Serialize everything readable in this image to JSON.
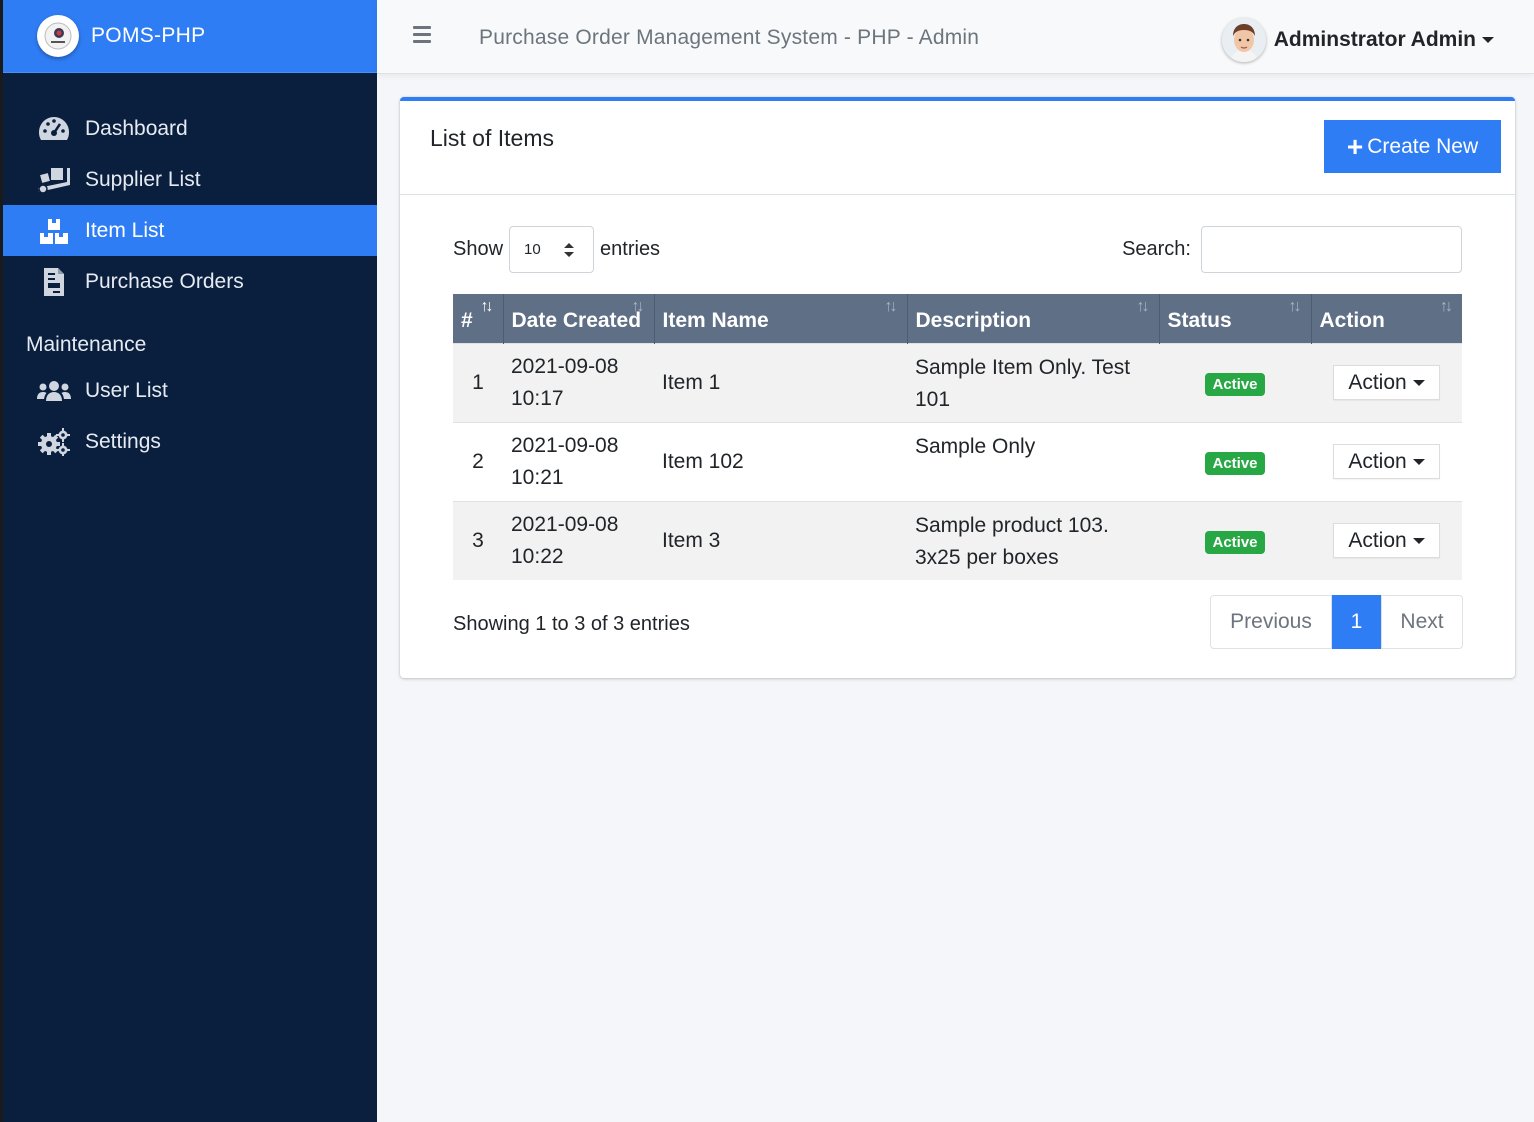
{
  "brand": {
    "name": "POMS-PHP",
    "logo_icon": "brand-logo-icon"
  },
  "topbar": {
    "title": "Purchase Order Management System - PHP - Admin",
    "user_name": "Adminstrator Admin"
  },
  "sidebar": {
    "items": [
      {
        "label": "Dashboard",
        "icon": "dashboard-icon"
      },
      {
        "label": "Supplier List",
        "icon": "truck-loading-icon"
      },
      {
        "label": "Item List",
        "icon": "boxes-icon",
        "active": true
      },
      {
        "label": "Purchase Orders",
        "icon": "file-invoice-icon"
      }
    ],
    "section_header": "Maintenance",
    "maintenance_items": [
      {
        "label": "User List",
        "icon": "users-icon"
      },
      {
        "label": "Settings",
        "icon": "cogs-icon"
      }
    ]
  },
  "card": {
    "title": "List of Items",
    "create_label": "Create New"
  },
  "controls": {
    "show_label": "Show",
    "page_size": "10",
    "entries_label": "entries",
    "search_label": "Search:",
    "search_value": ""
  },
  "table": {
    "headers": [
      "#",
      "Date Created",
      "Item Name",
      "Description",
      "Status",
      "Action"
    ],
    "rows": [
      {
        "num": "1",
        "date": "2021-09-08",
        "time": "10:17",
        "name": "Item 1",
        "desc_line1": "Sample Item Only. Test",
        "desc_line2": "101",
        "status": "Active",
        "action": "Action"
      },
      {
        "num": "2",
        "date": "2021-09-08",
        "time": "10:21",
        "name": "Item 102",
        "desc_line1": "Sample Only",
        "desc_line2": "",
        "status": "Active",
        "action": "Action"
      },
      {
        "num": "3",
        "date": "2021-09-08",
        "time": "10:22",
        "name": "Item 3",
        "desc_line1": "Sample product 103.",
        "desc_line2": "3x25 per boxes",
        "status": "Active",
        "action": "Action"
      }
    ]
  },
  "footer": {
    "info": "Showing 1 to 3 of 3 entries",
    "prev": "Previous",
    "current": "1",
    "next": "Next"
  },
  "colors": {
    "primary": "#2f7df5",
    "sidebar": "#0a1e3e",
    "table_header": "#5f6f86",
    "badge": "#28a745"
  }
}
